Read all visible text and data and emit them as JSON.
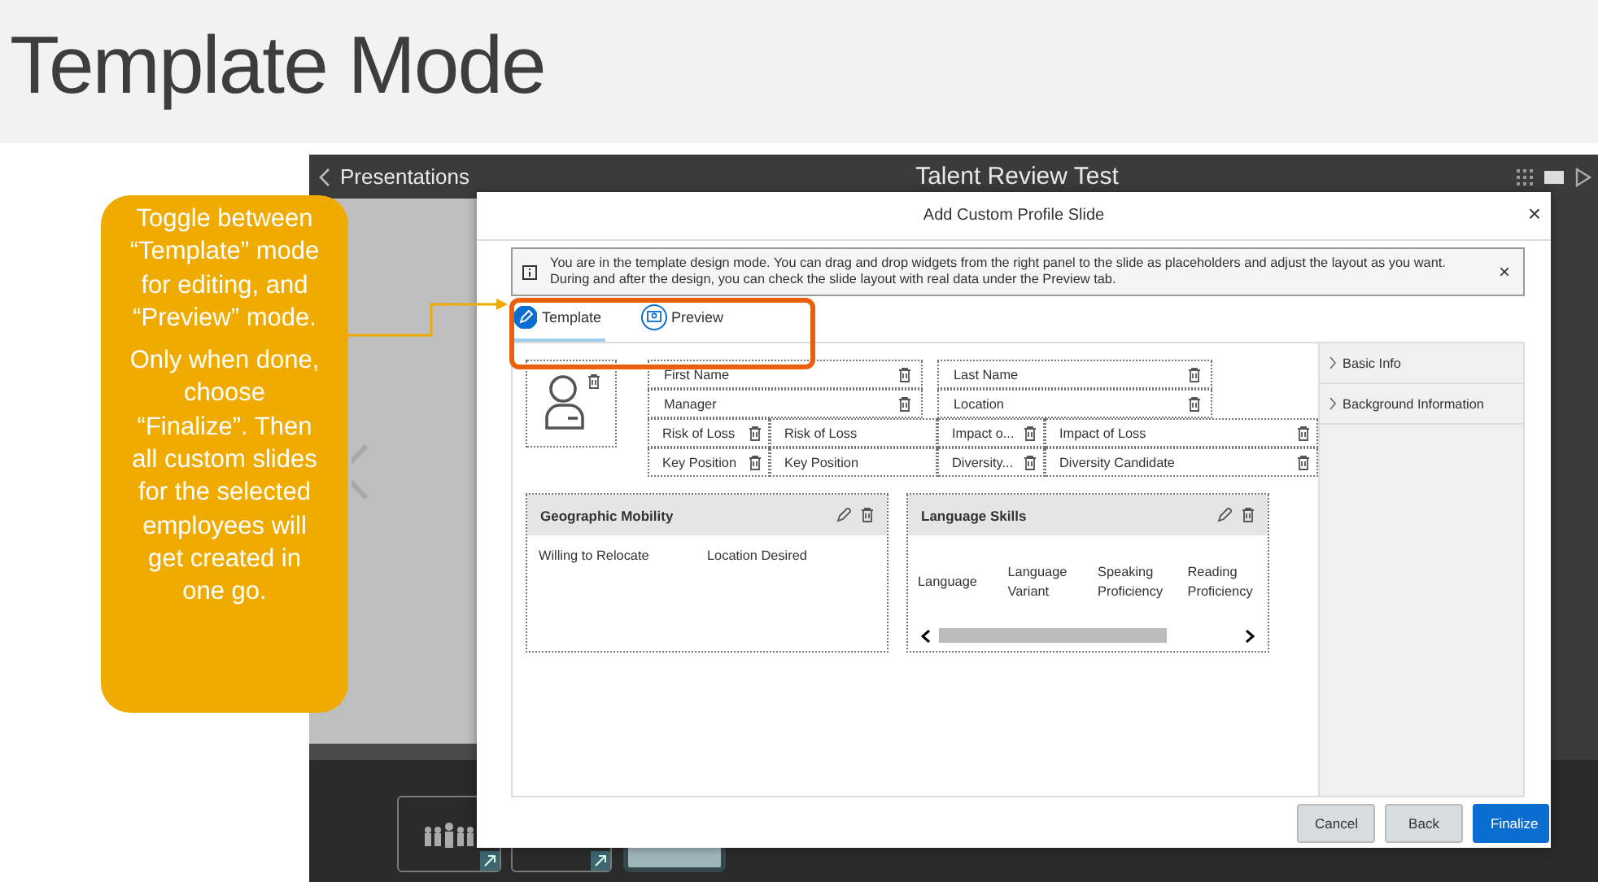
{
  "slide": {
    "title": "Template Mode"
  },
  "app": {
    "back_label": "Presentations",
    "title": "Talent Review Test"
  },
  "callout": {
    "paragraphs": [
      "Toggle between “Template” mode for editing, and “Preview” mode.",
      "Only when done, choose “Finalize”. Then all custom slides for the selected employees will get created in one go."
    ]
  },
  "dialog": {
    "title": "Add Custom Profile Slide",
    "close": "×",
    "info": "You are in the template design mode. You can drag and drop widgets from the right panel to the slide as placeholders and adjust the layout as you want. During and after the design, you can check the slide layout with real data under the Preview tab.",
    "info_close": "×",
    "tabs": [
      {
        "label": "Template",
        "selected": true
      },
      {
        "label": "Preview",
        "selected": false
      }
    ],
    "fields": [
      {
        "label": "First Name"
      },
      {
        "label": "Last Name"
      },
      {
        "label": "Manager"
      },
      {
        "label": "Location"
      }
    ],
    "attributes": [
      {
        "label": "Risk of Loss",
        "value": "Risk of Loss"
      },
      {
        "label": "Impact o...",
        "value": "Impact of Loss"
      },
      {
        "label": "Key Position",
        "value": "Key Position"
      },
      {
        "label": "Diversity...",
        "value": "Diversity Candidate"
      }
    ],
    "widgets": [
      {
        "title": "Geographic Mobility",
        "kind": "plain",
        "columns": [
          "Willing to Relocate",
          "Location Desired"
        ]
      },
      {
        "title": "Language Skills",
        "kind": "scrolling",
        "columns": [
          "Language",
          "Language Variant",
          "Speaking Proficiency",
          "Reading Proficiency"
        ]
      }
    ],
    "panel": [
      {
        "label": "Basic Info"
      },
      {
        "label": "Background Information"
      }
    ],
    "buttons": [
      {
        "label": "Cancel",
        "kind": "secondary"
      },
      {
        "label": "Back",
        "kind": "secondary"
      },
      {
        "label": "Finalize",
        "kind": "primary"
      }
    ]
  }
}
